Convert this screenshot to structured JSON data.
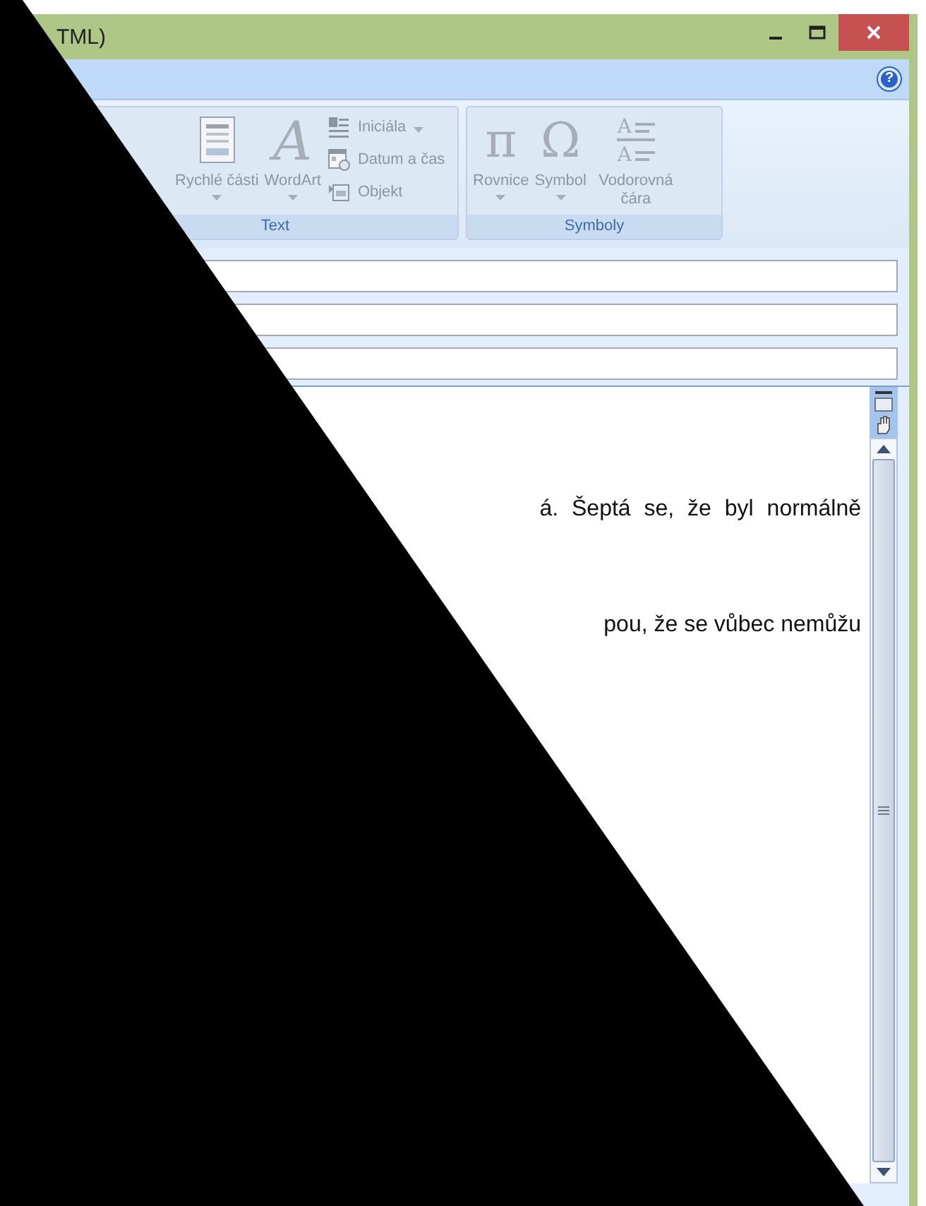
{
  "window": {
    "title": "TML)"
  },
  "help_button": "?",
  "ribbon": {
    "groups": [
      {
        "label": "Text",
        "large_buttons": [
          {
            "label": "Rychlé části",
            "dropdown": true
          },
          {
            "label": "WordArt",
            "dropdown": true,
            "icon_glyphs": [
              "A"
            ]
          }
        ],
        "small_buttons": [
          {
            "label": "Iniciála",
            "dropdown": true
          },
          {
            "label": "Datum a čas",
            "dropdown": false
          },
          {
            "label": "Objekt",
            "dropdown": false
          }
        ]
      },
      {
        "label": "Symboly",
        "large_buttons": [
          {
            "label": "Rovnice",
            "dropdown": true,
            "icon_glyphs": [
              "π"
            ]
          },
          {
            "label": "Symbol",
            "dropdown": true,
            "icon_glyphs": [
              "Ω"
            ]
          },
          {
            "label": "Vodorovná čára",
            "dropdown": false,
            "icon_glyphs": [
              "A",
              "A"
            ]
          }
        ]
      }
    ]
  },
  "body_lines": [
    "á. Šeptá se, že byl normálně",
    "pou, že se vůbec nemůžu"
  ]
}
